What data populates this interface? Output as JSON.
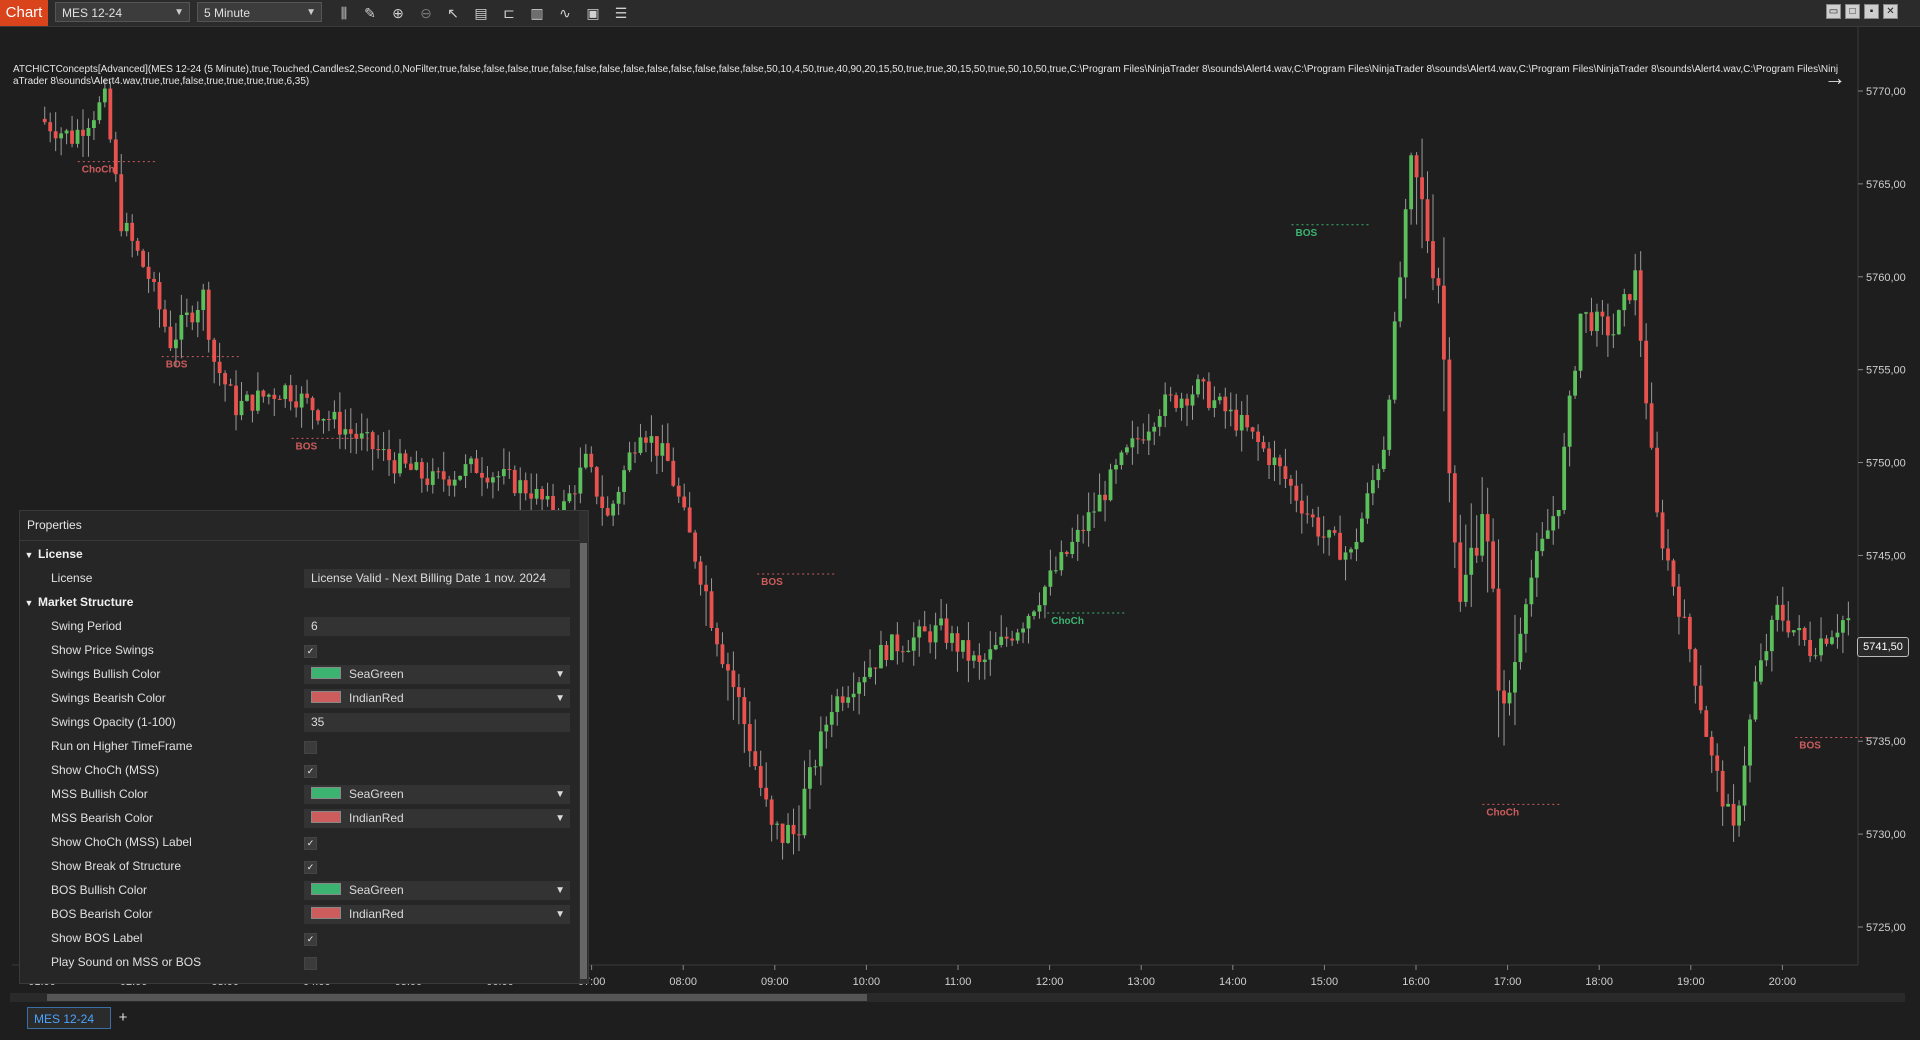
{
  "toolbar": {
    "chart_tab": "Chart",
    "instrument": "MES 12-24",
    "interval": "5 Minute",
    "icons": [
      "bar-type-icon",
      "pencil-icon",
      "zoom-in-icon",
      "zoom-out-icon",
      "pointer-icon",
      "data-box-icon",
      "draw-objects-icon",
      "strategies-icon",
      "indicators-icon",
      "properties-icon",
      "list-icon"
    ],
    "window_buttons": [
      "restore",
      "maximize",
      "pin",
      "close"
    ]
  },
  "indicator_text": "ATCHICTConcepts[Advanced](MES 12-24 (5 Minute),true,Touched,Candles2,Second,0,NoFilter,true,false,false,false,true,false,false,false,false,false,false,false,false,false,50,10,4,50,true,40,90,20,15,50,true,true,30,15,50,true,50,10,50,true,C:\\Program Files\\NinjaTrader 8\\sounds\\Alert4.wav,C:\\Program Files\\NinjaTrader 8\\sounds\\Alert4.wav,C:\\Program Files\\NinjaTrader 8\\sounds\\Alert4.wav,C:\\Program Files\\NinjaTrader 8\\sounds\\Alert4.wav,true,true,false,true,true,true,true,6,35)",
  "current_price": "5741,50",
  "chart_data": {
    "type": "candlestick",
    "y_ticks": [
      "5770,00",
      "5765,00",
      "5760,00",
      "5755,00",
      "5750,00",
      "5745,00",
      "5740,00",
      "5735,00",
      "5730,00",
      "5725,00"
    ],
    "x_ticks": [
      "01:00",
      "02:00",
      "03:00",
      "04:00",
      "05:00",
      "06:00",
      "07:00",
      "08:00",
      "09:00",
      "10:00",
      "11:00",
      "12:00",
      "13:00",
      "14:00",
      "15:00",
      "16:00",
      "17:00",
      "18:00",
      "19:00",
      "20:00"
    ],
    "ylim": [
      5722.5,
      5771.5
    ],
    "structure_labels": [
      {
        "text": "ChoCh",
        "time": "01:30",
        "price": 5766.2,
        "color": "#cd5c5c"
      },
      {
        "text": "BOS",
        "time": "02:25",
        "price": 5755.7,
        "color": "#cd5c5c"
      },
      {
        "text": "BOS",
        "time": "03:50",
        "price": 5751.3,
        "color": "#cd5c5c"
      },
      {
        "text": "BOS",
        "time": "06:05",
        "price": 5746.4,
        "color": "#cd5c5c"
      },
      {
        "text": "BOS",
        "time": "08:55",
        "price": 5744.0,
        "color": "#cd5c5c"
      },
      {
        "text": "ChoCh",
        "time": "12:05",
        "price": 5741.9,
        "color": "#3cb371"
      },
      {
        "text": "BOS",
        "time": "14:45",
        "price": 5762.8,
        "color": "#3cb371"
      },
      {
        "text": "ChoCh",
        "time": "16:50",
        "price": 5731.6,
        "color": "#cd5c5c"
      },
      {
        "text": "BOS",
        "time": "20:15",
        "price": 5735.2,
        "color": "#cd5c5c"
      }
    ]
  },
  "properties": {
    "title": "Properties",
    "sections": [
      {
        "name": "License",
        "rows": [
          {
            "label": "License",
            "type": "text",
            "value": "License Valid - Next Billing Date 1 nov. 2024"
          }
        ]
      },
      {
        "name": "Market Structure",
        "rows": [
          {
            "label": "Swing Period",
            "type": "text",
            "value": "6"
          },
          {
            "label": "Show Price Swings",
            "type": "check",
            "value": "true"
          },
          {
            "label": "Swings Bullish Color",
            "type": "color",
            "value": "SeaGreen",
            "color": "#3cb371"
          },
          {
            "label": "Swings Bearish Color",
            "type": "color",
            "value": "IndianRed",
            "color": "#cd5c5c"
          },
          {
            "label": "Swings Opacity (1-100)",
            "type": "text",
            "value": "35"
          },
          {
            "label": "Run on Higher TimeFrame",
            "type": "check",
            "value": "false"
          },
          {
            "label": "Show ChoCh (MSS)",
            "type": "check",
            "value": "true"
          },
          {
            "label": "MSS Bullish Color",
            "type": "color",
            "value": "SeaGreen",
            "color": "#3cb371"
          },
          {
            "label": "MSS Bearish Color",
            "type": "color",
            "value": "IndianRed",
            "color": "#cd5c5c"
          },
          {
            "label": "Show ChoCh (MSS) Label",
            "type": "check",
            "value": "true"
          },
          {
            "label": "Show Break of Structure",
            "type": "check",
            "value": "true"
          },
          {
            "label": "BOS Bullish Color",
            "type": "color",
            "value": "SeaGreen",
            "color": "#3cb371"
          },
          {
            "label": "BOS Bearish Color",
            "type": "color",
            "value": "IndianRed",
            "color": "#cd5c5c"
          },
          {
            "label": "Show BOS Label",
            "type": "check",
            "value": "true"
          },
          {
            "label": "Play Sound on MSS or BOS",
            "type": "check",
            "value": "false"
          }
        ]
      }
    ]
  },
  "bottom": {
    "tab": "MES 12-24",
    "add": "+"
  },
  "colors": {
    "bull": "#5bbf5b",
    "bear": "#e8524f",
    "background": "#1e1e1e"
  }
}
